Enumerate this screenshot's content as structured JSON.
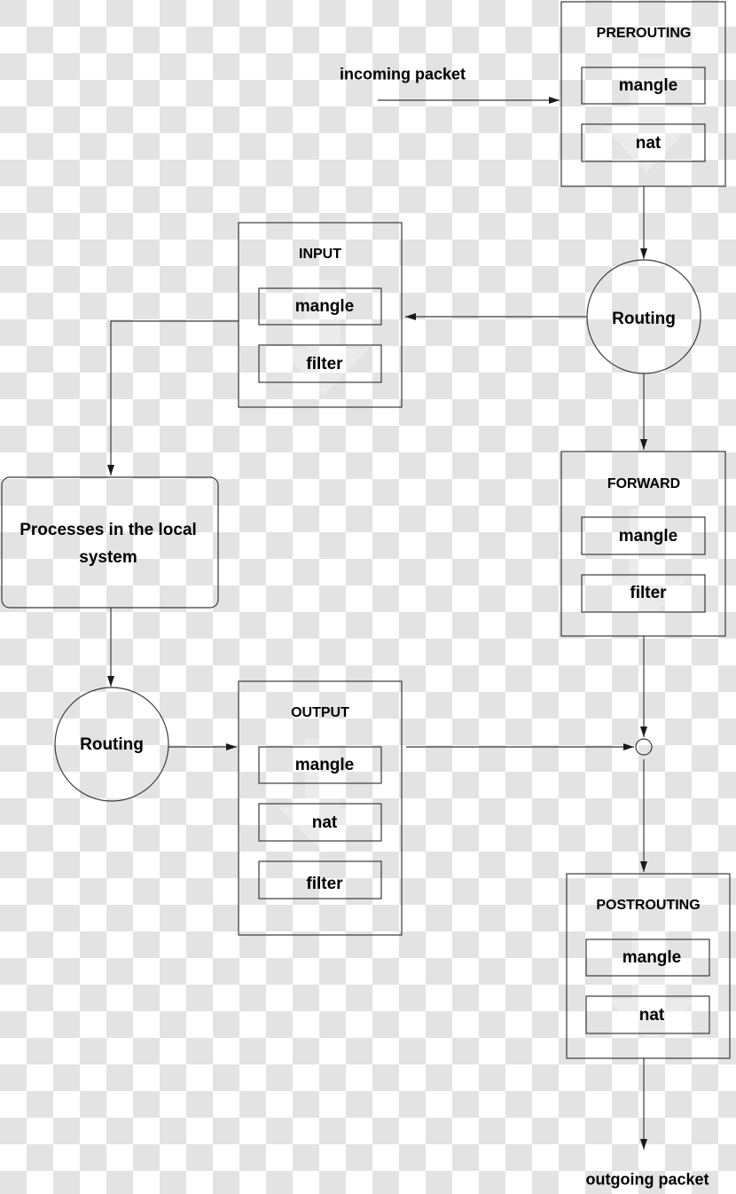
{
  "background": "transparency-checkerboard",
  "colors": {
    "stroke": "#3a3a3a",
    "text": "#000000",
    "checker_light": "#ffffff",
    "checker_dark": "#e3e3e3"
  },
  "labels": {
    "incoming": "incoming packet",
    "outgoing": "outgoing packet"
  },
  "chains": {
    "prerouting": {
      "title": "PREROUTING",
      "tables": [
        "mangle",
        "nat"
      ]
    },
    "input": {
      "title": "INPUT",
      "tables": [
        "mangle",
        "filter"
      ]
    },
    "forward": {
      "title": "FORWARD",
      "tables": [
        "mangle",
        "filter"
      ]
    },
    "output": {
      "title": "OUTPUT",
      "tables": [
        "mangle",
        "nat",
        "filter"
      ]
    },
    "postrouting": {
      "title": "POSTROUTING",
      "tables": [
        "mangle",
        "nat"
      ]
    }
  },
  "nodes": {
    "routing_top": "Routing",
    "routing_bottom": "Routing",
    "processes": "Processes in the local system"
  },
  "edges": [
    {
      "from": "incoming packet",
      "to": "PREROUTING"
    },
    {
      "from": "PREROUTING",
      "to": "Routing (top)"
    },
    {
      "from": "Routing (top)",
      "to": "INPUT"
    },
    {
      "from": "Routing (top)",
      "to": "FORWARD"
    },
    {
      "from": "INPUT",
      "to": "Processes in the local system"
    },
    {
      "from": "Processes in the local system",
      "to": "Routing (bottom)"
    },
    {
      "from": "Routing (bottom)",
      "to": "OUTPUT"
    },
    {
      "from": "OUTPUT",
      "to": "junction"
    },
    {
      "from": "FORWARD",
      "to": "junction"
    },
    {
      "from": "junction",
      "to": "POSTROUTING"
    },
    {
      "from": "POSTROUTING",
      "to": "outgoing packet"
    }
  ]
}
